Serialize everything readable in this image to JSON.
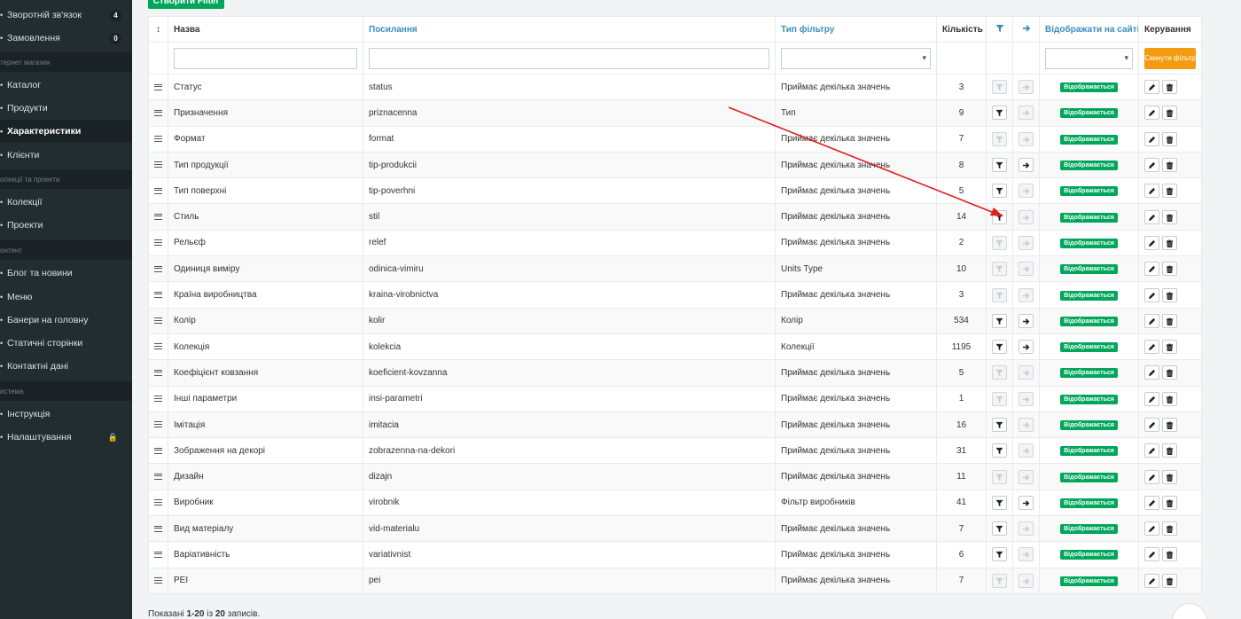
{
  "sidebar": {
    "items": [
      {
        "label": "Зворотній зв'язок",
        "icon": "chat-icon",
        "badge": "4",
        "active": false
      },
      {
        "label": "Замовлення",
        "icon": "orders-icon",
        "badge": "0",
        "active": false
      },
      {
        "label": "Каталог",
        "icon": "catalog-icon",
        "active": false
      },
      {
        "label": "Продукти",
        "icon": "products-icon",
        "active": false
      },
      {
        "label": "Характеристики",
        "icon": "features-icon",
        "active": true
      },
      {
        "label": "Клієнти",
        "icon": "clients-icon",
        "active": false
      },
      {
        "label": "Колекції",
        "icon": "collections-icon",
        "active": false
      },
      {
        "label": "Проекти",
        "icon": "projects-icon",
        "active": false
      },
      {
        "label": "Блог та новини",
        "icon": "blog-icon",
        "active": false
      },
      {
        "label": "Меню",
        "icon": "menu-icon",
        "active": false
      },
      {
        "label": "Банери на головну",
        "icon": "banners-icon",
        "active": false
      },
      {
        "label": "Статичні сторінки",
        "icon": "pages-icon",
        "active": false
      },
      {
        "label": "Контактні дані",
        "icon": "contacts-icon",
        "active": false
      },
      {
        "label": "Інструкція",
        "icon": "instruction-icon",
        "active": false
      },
      {
        "label": "Налаштування",
        "icon": "settings-icon",
        "active": false
      }
    ],
    "headers": [
      "тернет магазин",
      "олекції та проекти",
      "онтент",
      "истема"
    ]
  },
  "toolbar": {
    "create_label": "Створити Filter"
  },
  "table": {
    "columns": {
      "sort": "↕",
      "name": "Назва",
      "url": "Посилання",
      "type": "Тип фільтру",
      "qty": "Кількість",
      "filter": "filter-icon",
      "arrow": "arrow-right-icon",
      "show": "Відображати на сайті",
      "control": "Керування"
    },
    "reset_label": "Скинути фільтр",
    "rows": [
      {
        "name": "Статус",
        "url": "status",
        "type": "Приймає декілька значень",
        "qty": "3",
        "f": false,
        "a": false,
        "show": "Відображається"
      },
      {
        "name": "Призначення",
        "url": "priznacenna",
        "type": "Тип",
        "qty": "9",
        "f": true,
        "a": false,
        "show": "Відображається"
      },
      {
        "name": "Формат",
        "url": "format",
        "type": "Приймає декілька значень",
        "qty": "7",
        "f": false,
        "a": false,
        "show": "Відображається"
      },
      {
        "name": "Тип продукції",
        "url": "tip-produkcii",
        "type": "Приймає декілька значень",
        "qty": "8",
        "f": true,
        "a": true,
        "show": "Відображається"
      },
      {
        "name": "Тип поверхні",
        "url": "tip-poverhni",
        "type": "Приймає декілька значень",
        "qty": "5",
        "f": true,
        "a": false,
        "show": "Відображається"
      },
      {
        "name": "Стиль",
        "url": "stil",
        "type": "Приймає декілька значень",
        "qty": "14",
        "f": true,
        "a": false,
        "show": "Відображається"
      },
      {
        "name": "Рельєф",
        "url": "relef",
        "type": "Приймає декілька значень",
        "qty": "2",
        "f": false,
        "a": false,
        "show": "Відображається"
      },
      {
        "name": "Одиниця виміру",
        "url": "odinica-vimiru",
        "type": "Units Type",
        "qty": "10",
        "f": false,
        "a": false,
        "show": "Відображається"
      },
      {
        "name": "Країна виробництва",
        "url": "kraina-virobnictva",
        "type": "Приймає декілька значень",
        "qty": "3",
        "f": false,
        "a": false,
        "show": "Відображається"
      },
      {
        "name": "Колір",
        "url": "kolir",
        "type": "Колір",
        "qty": "534",
        "f": true,
        "a": true,
        "show": "Відображається"
      },
      {
        "name": "Колекція",
        "url": "kolekcia",
        "type": "Колекції",
        "qty": "1195",
        "f": true,
        "a": true,
        "show": "Відображається"
      },
      {
        "name": "Коефіцієнт ковзання",
        "url": "koeficient-kovzanna",
        "type": "Приймає декілька значень",
        "qty": "5",
        "f": false,
        "a": false,
        "show": "Відображається"
      },
      {
        "name": "Інші параметри",
        "url": "insi-parametri",
        "type": "Приймає декілька значень",
        "qty": "1",
        "f": false,
        "a": false,
        "show": "Відображається"
      },
      {
        "name": "Імітація",
        "url": "imitacia",
        "type": "Приймає декілька значень",
        "qty": "16",
        "f": true,
        "a": false,
        "show": "Відображається"
      },
      {
        "name": "Зображення на декорі",
        "url": "zobrazenna-na-dekori",
        "type": "Приймає декілька значень",
        "qty": "31",
        "f": true,
        "a": false,
        "show": "Відображається"
      },
      {
        "name": "Дизайн",
        "url": "dizajn",
        "type": "Приймає декілька значень",
        "qty": "11",
        "f": false,
        "a": false,
        "show": "Відображається"
      },
      {
        "name": "Виробник",
        "url": "virobnik",
        "type": "Фільтр виробників",
        "qty": "41",
        "f": true,
        "a": true,
        "show": "Відображається"
      },
      {
        "name": "Вид матеріалу",
        "url": "vid-materialu",
        "type": "Приймає декілька значень",
        "qty": "7",
        "f": true,
        "a": false,
        "show": "Відображається"
      },
      {
        "name": "Варіативність",
        "url": "variativnist",
        "type": "Приймає декілька значень",
        "qty": "6",
        "f": true,
        "a": false,
        "show": "Відображається"
      },
      {
        "name": "PEI",
        "url": "pei",
        "type": "Приймає декілька значень",
        "qty": "7",
        "f": false,
        "a": false,
        "show": "Відображається"
      }
    ]
  },
  "footer": {
    "prefix": "Показані ",
    "range": "1-20",
    "middle": " із ",
    "total": "20",
    "suffix": " записів."
  },
  "colors": {
    "sidebar": "#222d32",
    "accent_green": "#00a65a",
    "accent_orange": "#f39c12",
    "link_blue": "#3c8dbc",
    "annotation_red": "#e02020"
  }
}
